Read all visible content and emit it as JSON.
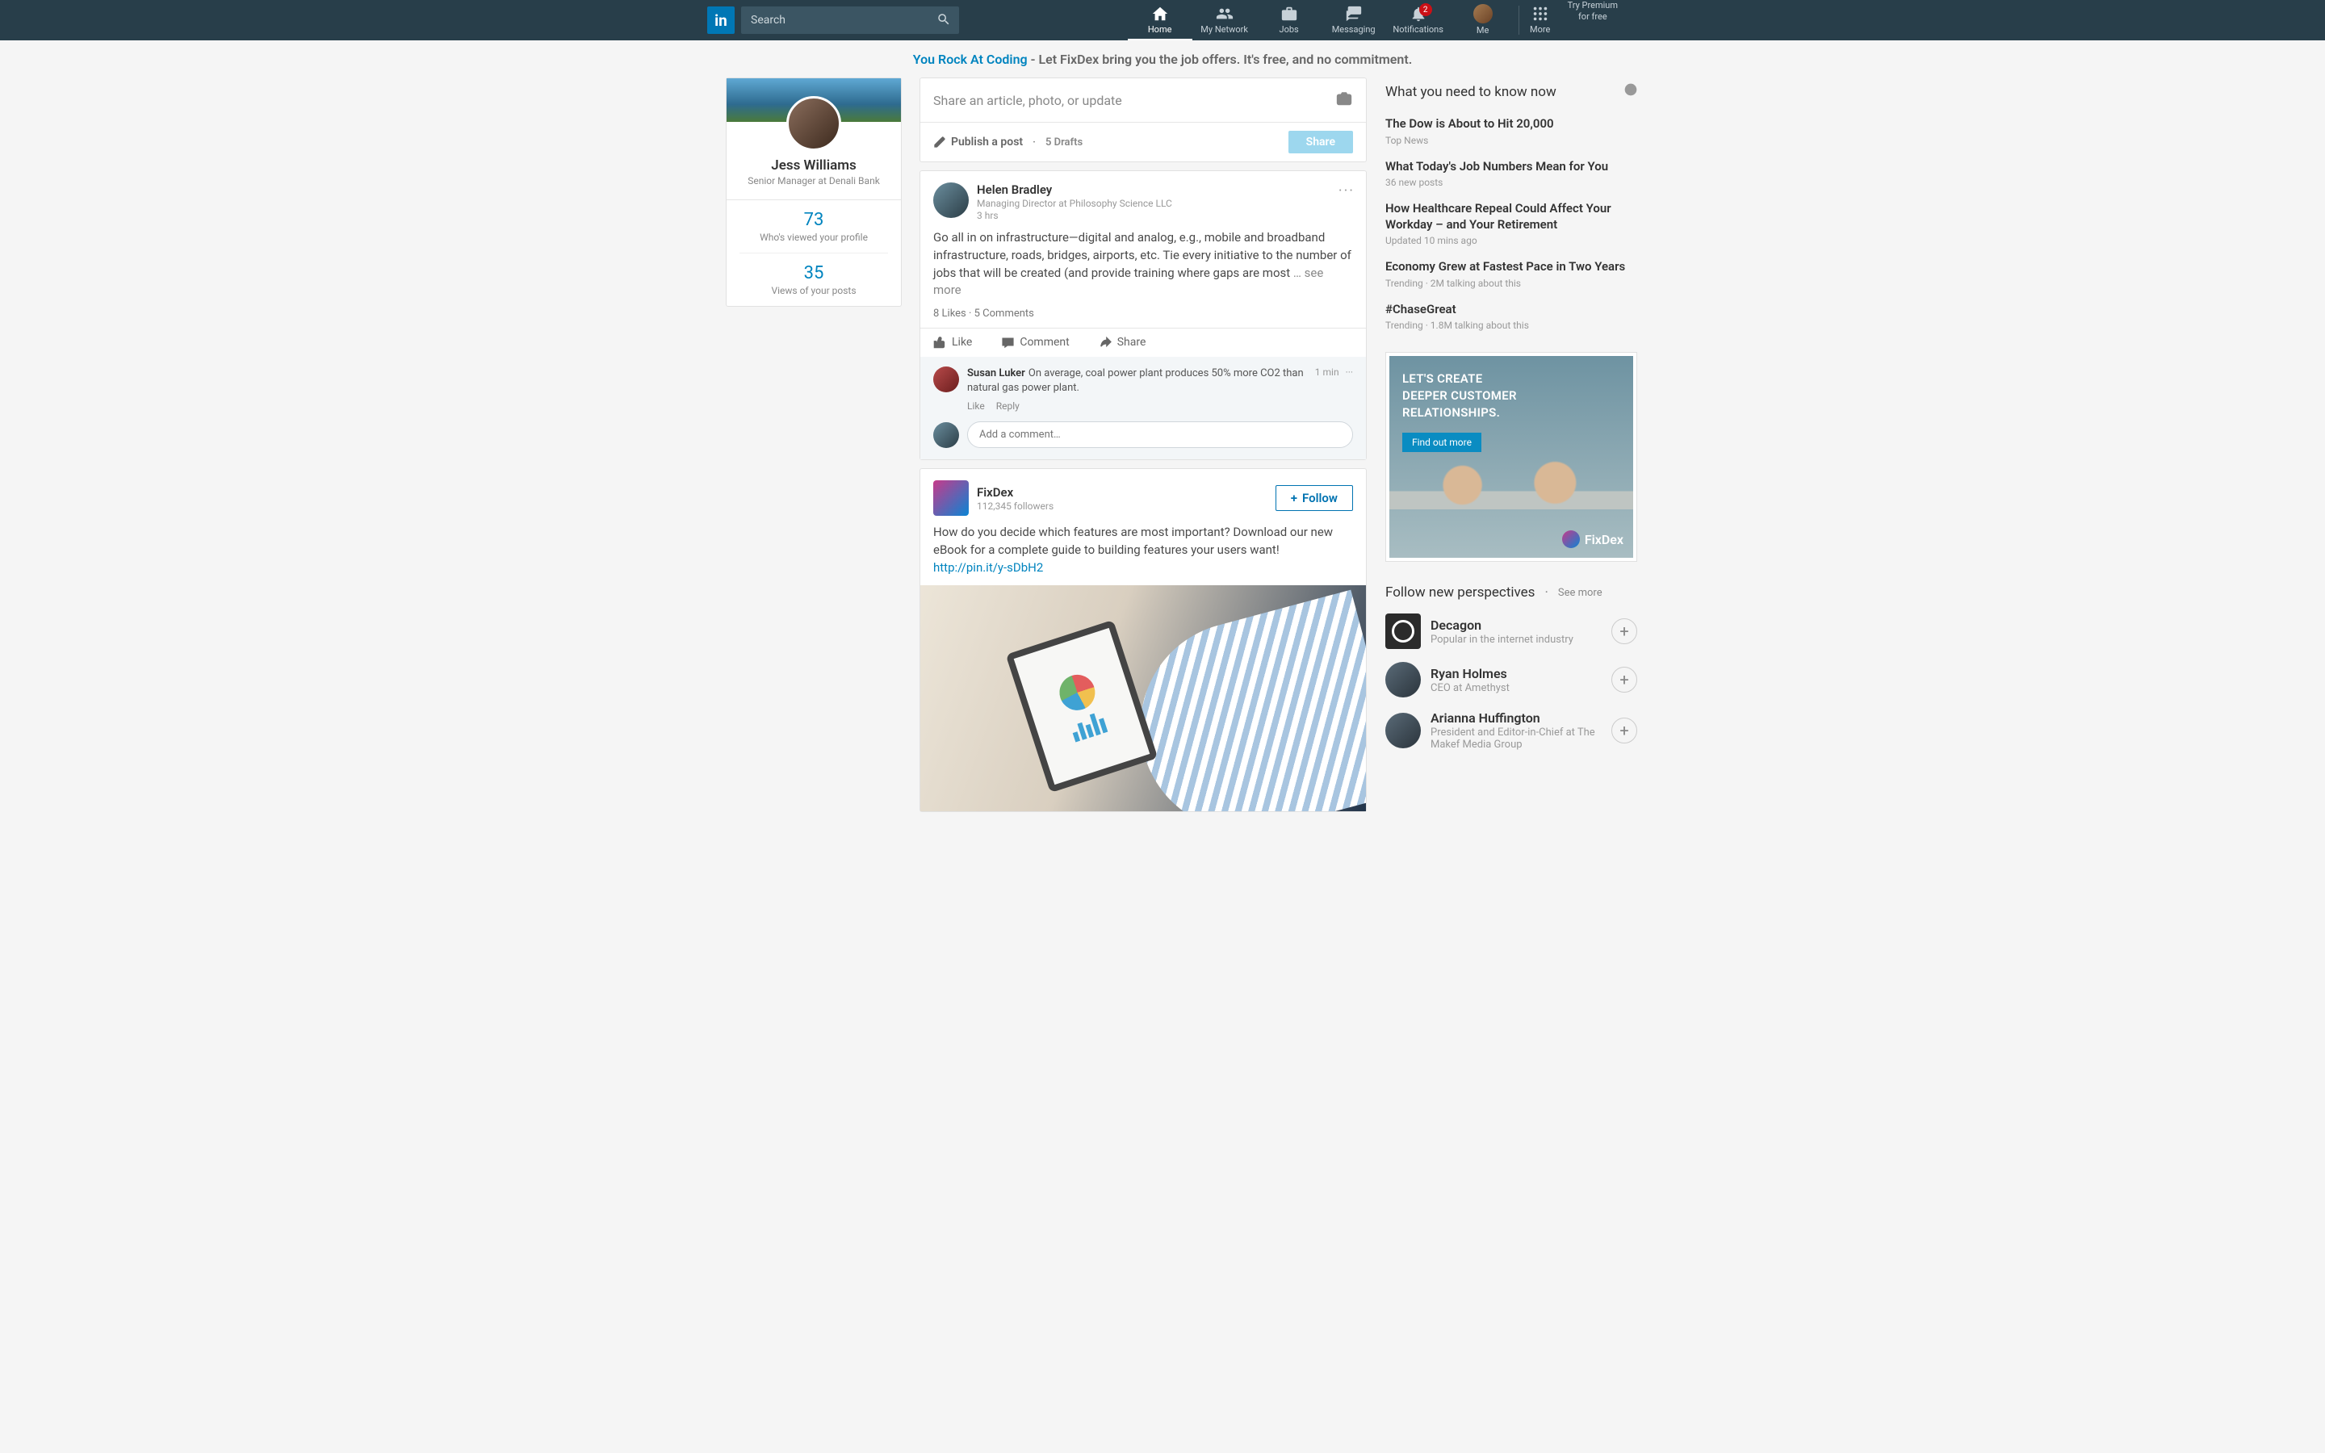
{
  "nav": {
    "search_placeholder": "Search",
    "items": [
      "Home",
      "My Network",
      "Jobs",
      "Messaging",
      "Notifications",
      "Me",
      "More"
    ],
    "premium_line1": "Try Premium",
    "premium_line2": "for free",
    "notification_badge": "2"
  },
  "promo": {
    "lead": "You Rock At Coding",
    "rest": " - Let FixDex bring you the job offers. It's free, and no commitment."
  },
  "profile": {
    "name": "Jess Williams",
    "title": "Senior Manager at Denali Bank",
    "stats": [
      {
        "num": "73",
        "label": "Who's viewed your profile"
      },
      {
        "num": "35",
        "label": "Views of your posts"
      }
    ]
  },
  "composer": {
    "prompt": "Share an article, photo, or update",
    "publish": "Publish a post",
    "drafts_sep": "·",
    "drafts": "5 Drafts",
    "share": "Share"
  },
  "post1": {
    "author": "Helen Bradley",
    "subtitle": "Managing Director at Philosophy Science LLC",
    "time": "3 hrs",
    "body": "Go all in on infrastructure—digital and analog, e.g., mobile and broadband infrastructure, roads, bridges, airports, etc. Tie every initiative to the number of jobs that will be created (and provide training where gaps are most ",
    "more": "… see more",
    "likes": "8 Likes",
    "comments_count": "5 Comments",
    "sep": "·",
    "actions": {
      "like": "Like",
      "comment": "Comment",
      "share": "Share"
    },
    "comment": {
      "name": "Susan Luker",
      "text": "On average, coal power plant produces 50% more CO2 than natural gas power plant.",
      "time": "1 min",
      "like": "Like",
      "reply": "Reply"
    },
    "add_comment_placeholder": "Add a comment…"
  },
  "post2": {
    "author": "FixDex",
    "followers": "112,345 followers",
    "follow_btn": "Follow",
    "body": "How do you decide which features are most important? Download our new eBook for a complete guide to building features your users want! ",
    "link": "http://pin.it/y-sDbH2"
  },
  "news": {
    "heading": "What you need to know now",
    "items": [
      {
        "title": "The Dow is About to Hit 20,000",
        "meta": "Top News"
      },
      {
        "title": "What Today's Job Numbers Mean for You",
        "meta": "36 new posts"
      },
      {
        "title": "How Healthcare Repeal Could Affect Your Workday – and Your Retirement",
        "meta": "Updated 10 mins ago"
      },
      {
        "title": "Economy Grew at Fastest Pace in Two Years",
        "meta": "Trending  ·  2M talking about this"
      },
      {
        "title": "#ChaseGreat",
        "meta": "Trending  ·  1.8M talking about this"
      }
    ]
  },
  "ad": {
    "line1": "LET'S CREATE",
    "line2": "DEEPER CUSTOMER",
    "line3": "RELATIONSHIPS.",
    "cta": "Find out more",
    "brand": "FixDex"
  },
  "follow": {
    "heading": "Follow new perspectives",
    "sep": "·",
    "see_more": "See more",
    "items": [
      {
        "name": "Decagon",
        "sub": "Popular in the internet industry",
        "square": true
      },
      {
        "name": "Ryan Holmes",
        "sub": "CEO at Amethyst",
        "square": false
      },
      {
        "name": "Arianna Huffington",
        "sub": "President and Editor-in-Chief at The Makef Media Group",
        "square": false
      }
    ]
  }
}
